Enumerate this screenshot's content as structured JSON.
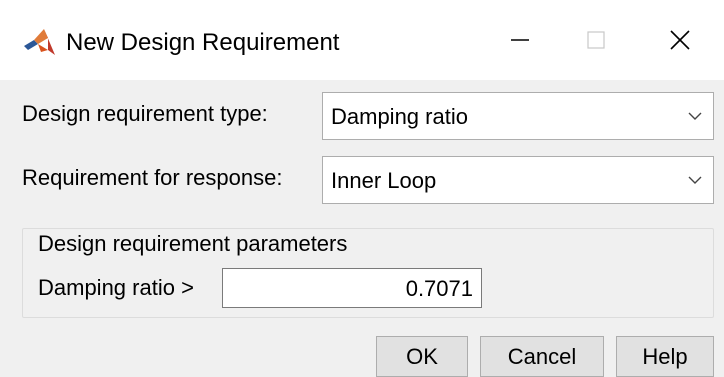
{
  "window": {
    "title": "New Design Requirement",
    "icon": "matlab-logo-icon",
    "controls": [
      "minimize-icon",
      "maximize-icon",
      "close-icon"
    ]
  },
  "form": {
    "requirement_type": {
      "label": "Design requirement type:",
      "value": "Damping ratio"
    },
    "response": {
      "label": "Requirement for response:",
      "value": "Inner Loop"
    },
    "parameters": {
      "group_title": "Design requirement parameters",
      "damping_label": "Damping ratio >",
      "damping_value": "0.7071"
    }
  },
  "buttons": {
    "ok": "OK",
    "cancel": "Cancel",
    "help": "Help"
  },
  "colors": {
    "client_bg": "#f0f0f0",
    "button_bg": "#e1e1e1",
    "border": "#adadad",
    "logo_orange": "#d9531e",
    "logo_blue": "#2b5797"
  }
}
